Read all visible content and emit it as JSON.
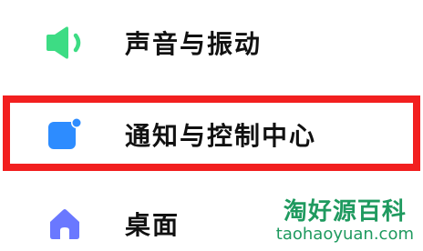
{
  "settings_list": {
    "items": [
      {
        "label": "声音与振动",
        "icon": "speaker-icon",
        "icon_color": "#3ddc84"
      },
      {
        "label": "通知与控制中心",
        "icon": "notification-icon",
        "icon_color": "#2d8cff"
      },
      {
        "label": "桌面",
        "icon": "home-icon",
        "icon_color": "#6a78ff"
      }
    ],
    "highlighted_item": "通知与控制中心",
    "highlight_color": "#f21f1f"
  },
  "watermark": {
    "chinese": "淘好源百科",
    "english": "taohaoyuan.com",
    "color": "#1f9a5f"
  }
}
